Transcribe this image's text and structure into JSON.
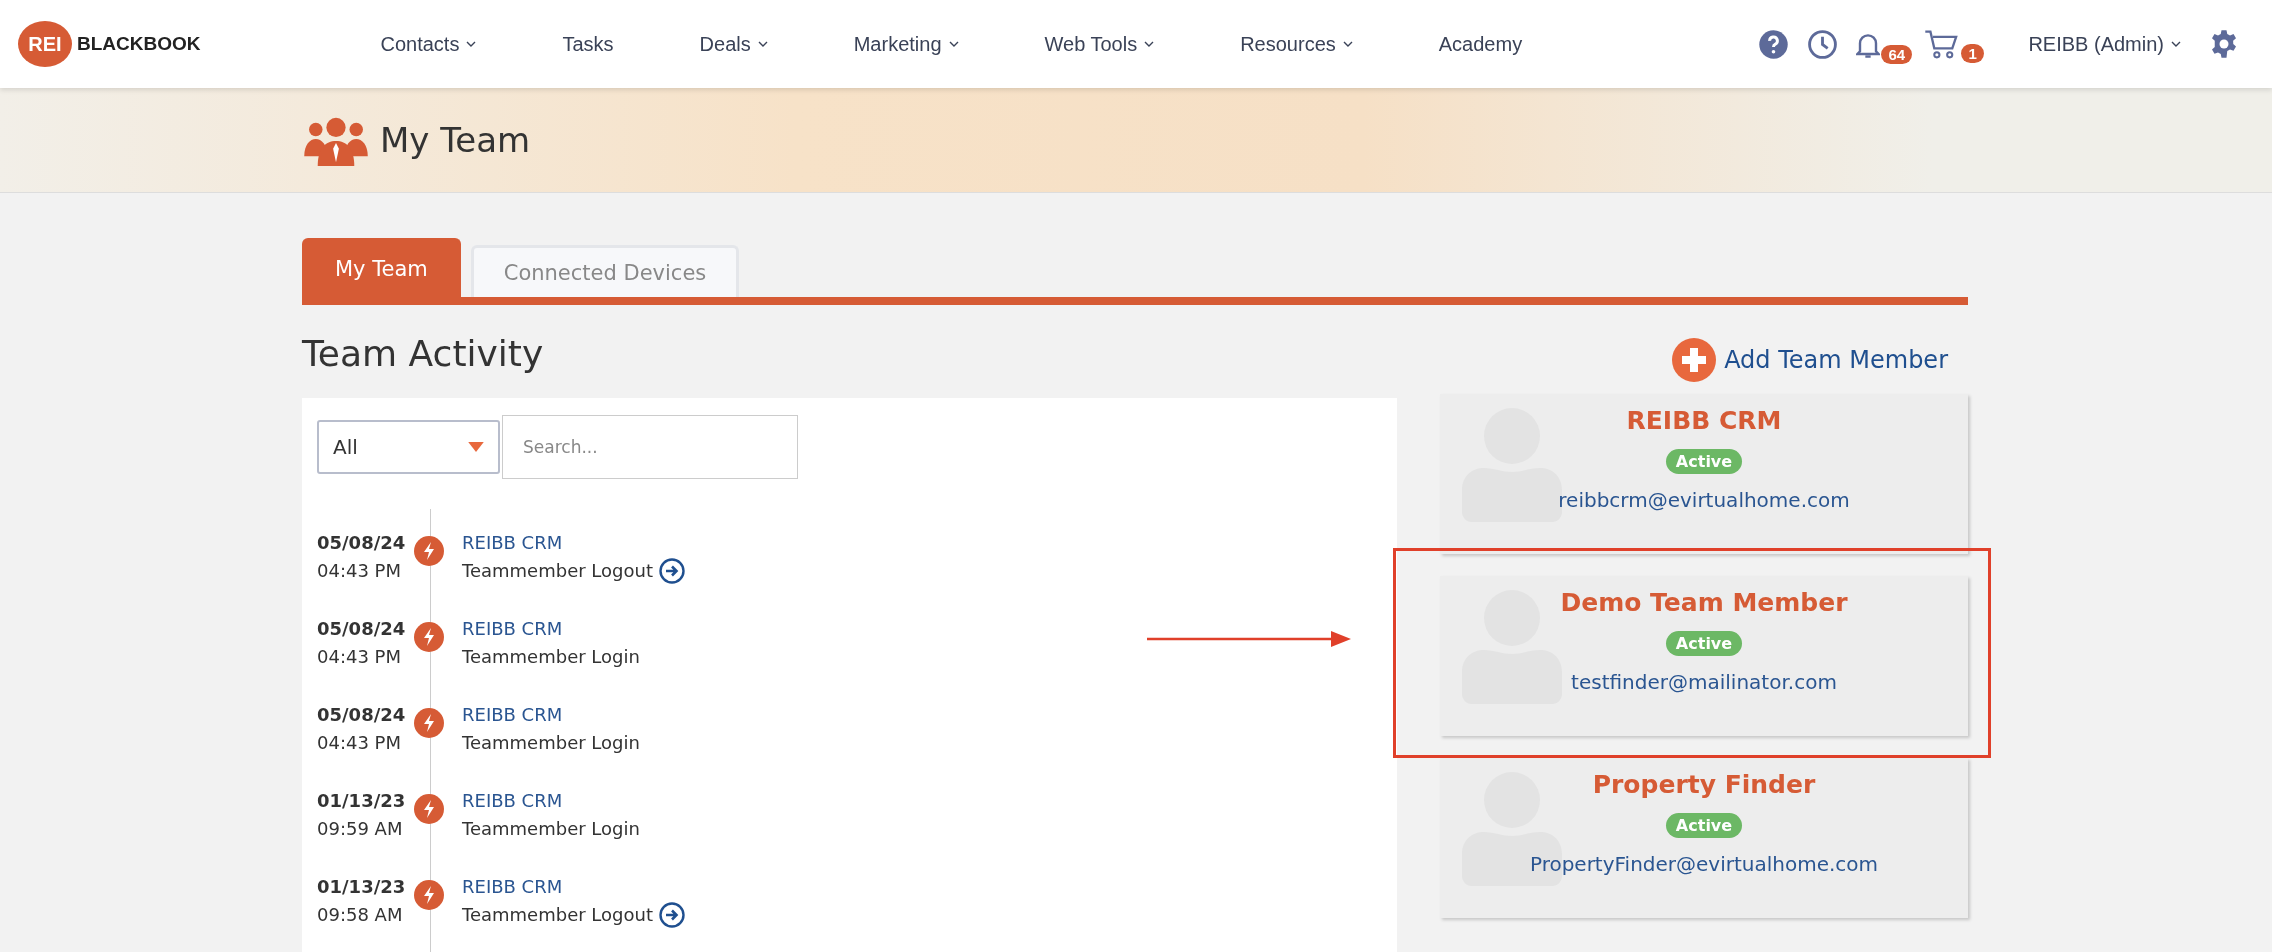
{
  "nav": {
    "logo": {
      "badge": "REI",
      "name": "BLACKBOOK"
    },
    "menu": [
      {
        "label": "Contacts",
        "dropdown": true
      },
      {
        "label": "Tasks",
        "dropdown": false
      },
      {
        "label": "Deals",
        "dropdown": true
      },
      {
        "label": "Marketing",
        "dropdown": true
      },
      {
        "label": "Web Tools",
        "dropdown": true
      },
      {
        "label": "Resources",
        "dropdown": true
      },
      {
        "label": "Academy",
        "dropdown": false
      }
    ],
    "notifications": "64",
    "cart": "1",
    "user": "REIBB (Admin)"
  },
  "page_header": {
    "title": "My Team"
  },
  "tabs": [
    {
      "label": "My Team",
      "selected": true
    },
    {
      "label": "Connected Devices",
      "selected": false
    }
  ],
  "activity": {
    "title": "Team Activity",
    "filter": "All",
    "search": {
      "placeholder": "Search..."
    },
    "events": [
      {
        "date": "05/08/24",
        "time": "04:43 PM",
        "member": "REIBB CRM",
        "action": "Teammember Logout",
        "kind": "logout"
      },
      {
        "date": "05/08/24",
        "time": "04:43 PM",
        "member": "REIBB CRM",
        "action": "Teammember Login",
        "kind": "login"
      },
      {
        "date": "05/08/24",
        "time": "04:43 PM",
        "member": "REIBB CRM",
        "action": "Teammember Login",
        "kind": "login"
      },
      {
        "date": "01/13/23",
        "time": "09:59 AM",
        "member": "REIBB CRM",
        "action": "Teammember Login",
        "kind": "login"
      },
      {
        "date": "01/13/23",
        "time": "09:58 AM",
        "member": "REIBB CRM",
        "action": "Teammember Logout",
        "kind": "logout"
      }
    ]
  },
  "team": {
    "add_label": "Add Team Member",
    "members": [
      {
        "name": "REIBB CRM",
        "status": "Active",
        "email": "reibbcrm@evirtualhome.com",
        "highlighted": false
      },
      {
        "name": "Demo Team Member",
        "status": "Active",
        "email": "testfinder@mailinator.com",
        "highlighted": true
      },
      {
        "name": "Property Finder",
        "status": "Active",
        "email": "PropertyFinder@evirtualhome.com",
        "highlighted": false
      }
    ]
  }
}
